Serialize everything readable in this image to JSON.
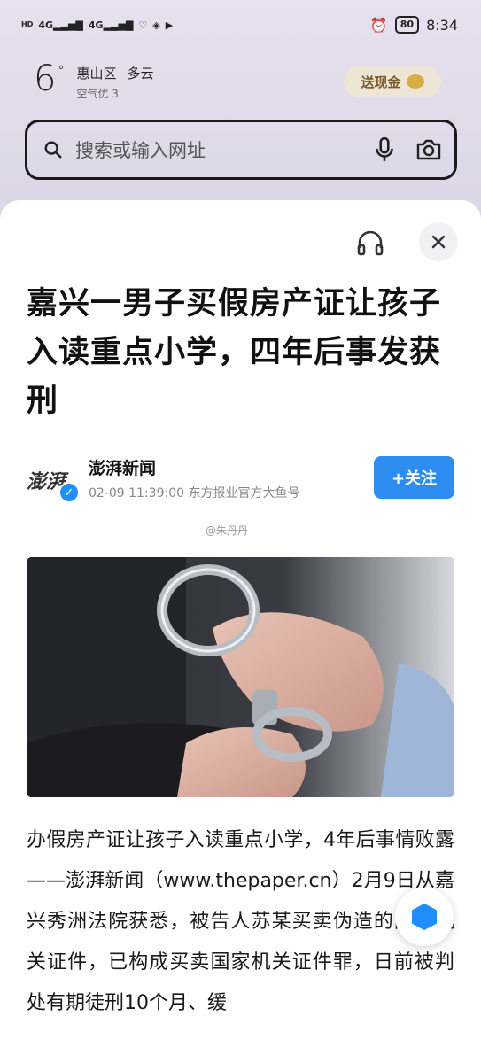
{
  "status_bar": {
    "left_labels": [
      "HD",
      "4G",
      "4G"
    ],
    "battery": "80",
    "time": "8:34"
  },
  "weather": {
    "temperature": "6",
    "degree_symbol": "°",
    "district": "惠山区",
    "condition": "多云",
    "air_quality": "空气优 3"
  },
  "promo": {
    "label": "送现金"
  },
  "search": {
    "placeholder": "搜索或输入网址"
  },
  "article": {
    "title": "嘉兴一男子买假房产证让孩子入读重点小学，四年后事发获刑",
    "source": {
      "logo_text": "澎湃",
      "name": "澎湃新闻",
      "datetime": "02-09 11:39:00",
      "publisher": "东方报业官方大鱼号"
    },
    "follow_label": "+关注",
    "watermark": "@朱丹丹",
    "body": "办假房产证让孩子入读重点小学，4年后事情败露——澎湃新闻（www.thepaper.cn）2月9日从嘉兴秀洲法院获悉，被告人苏某买卖伪造的国家机关证件，已构成买卖国家机关证件罪，日前被判处有期徒刑10个月、缓"
  },
  "colors": {
    "accent": "#2d8cf0",
    "sheet": "#ffffff",
    "background": "#dcd9e6"
  }
}
